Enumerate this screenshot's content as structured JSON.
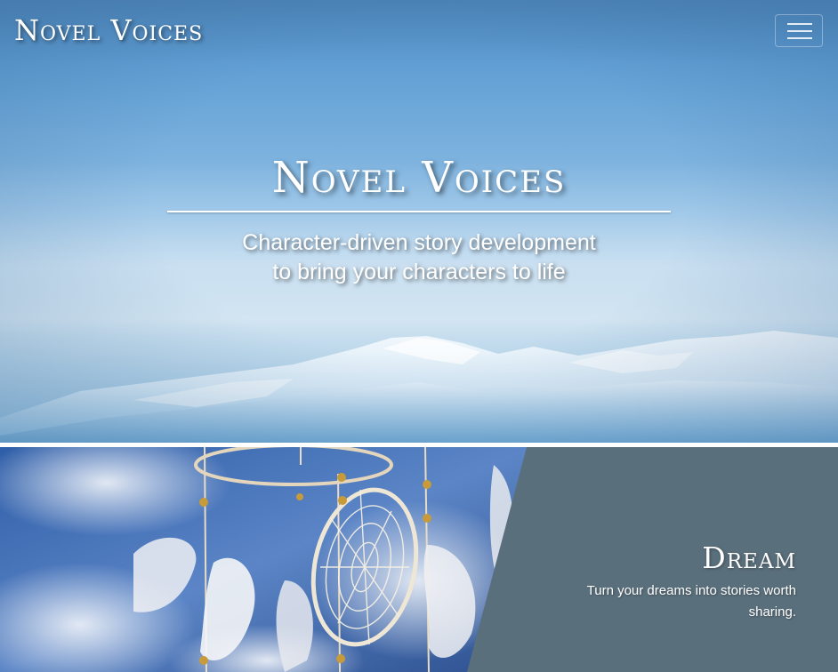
{
  "navbar": {
    "brand": "Novel Voices",
    "toggler_icon": "hamburger-menu-icon"
  },
  "hero": {
    "title": "Novel Voices",
    "subtitle_line1": "Character-driven story development",
    "subtitle_line2": "to bring your characters to life",
    "background": "snowy-mountains-under-blue-sky"
  },
  "feature": {
    "title": "Dream",
    "text": "Turn your dreams into stories worth sharing.",
    "image": "dreamcatcher-with-feathers",
    "panel_color": "#5a6f7c"
  },
  "colors": {
    "sky": "#6aa6d8",
    "panel": "#5a6f7c",
    "text": "#ffffff"
  }
}
